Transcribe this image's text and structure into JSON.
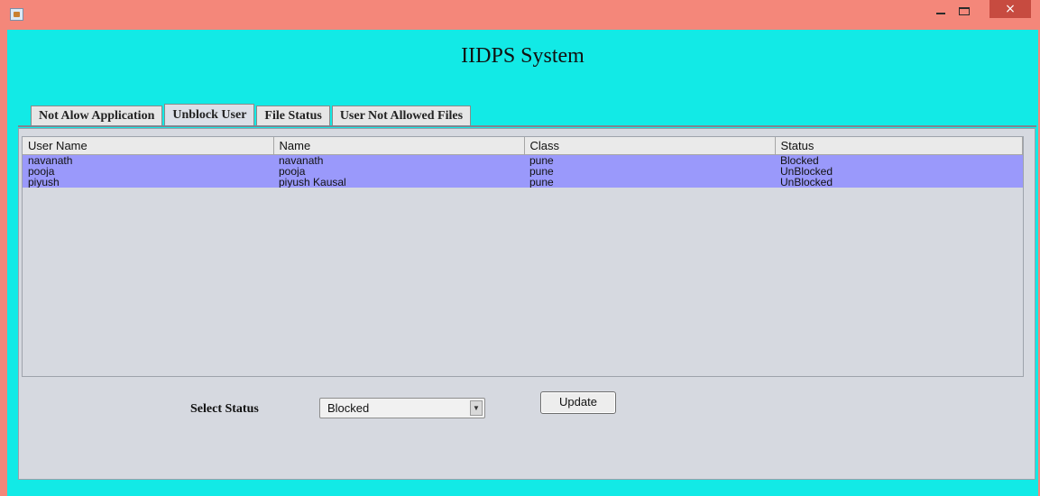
{
  "window": {
    "close_glyph": "×",
    "icons": [
      "java-app-icon",
      "minimize-icon",
      "maximize-icon",
      "close-icon"
    ]
  },
  "app": {
    "title": "IIDPS System"
  },
  "tabs": [
    {
      "label": "Not Alow Application",
      "active": false
    },
    {
      "label": "Unblock User",
      "active": true
    },
    {
      "label": "File Status",
      "active": false
    },
    {
      "label": "User Not Allowed Files",
      "active": false
    }
  ],
  "table": {
    "columns": [
      "User Name",
      "Name",
      "Class",
      "Status"
    ],
    "rows": [
      [
        "navanath",
        "navanath",
        "pune",
        "Blocked"
      ],
      [
        "pooja",
        "pooja",
        "pune",
        "UnBlocked"
      ],
      [
        "piyush",
        "piyush Kausal",
        "pune",
        "UnBlocked"
      ]
    ]
  },
  "controls": {
    "status_label": "Select Status",
    "status_selected": "Blocked",
    "dropdown_arrow": "▼",
    "update_label": "Update"
  },
  "colors": {
    "frame_background": "#12eae6",
    "titlebar": "#f4877a",
    "selected_row": "#9a99fb",
    "panel": "#d6d9e0"
  }
}
